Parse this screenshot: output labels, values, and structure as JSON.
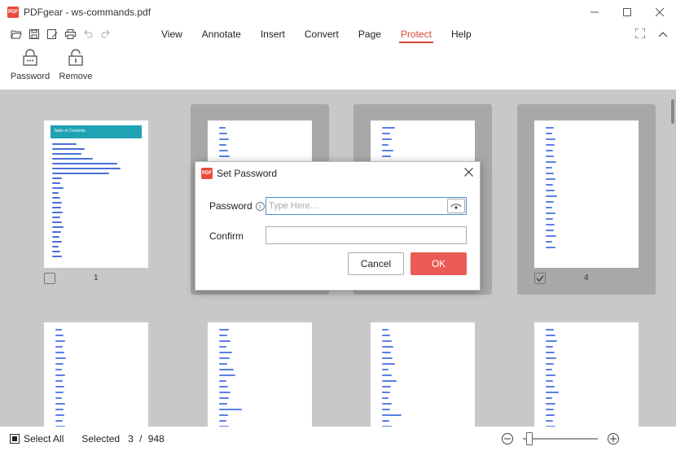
{
  "window": {
    "title": "PDFgear - ws-commands.pdf",
    "logo_text": "PDF"
  },
  "menus": [
    "View",
    "Annotate",
    "Insert",
    "Convert",
    "Page",
    "Protect",
    "Help"
  ],
  "active_menu": "Protect",
  "ribbon": {
    "password_label": "Password",
    "remove_label": "Remove"
  },
  "pages": [
    {
      "number": "1",
      "checked": false,
      "toc_title": "Table of Contents"
    },
    {
      "number": "",
      "checked": false
    },
    {
      "number": "",
      "checked": false
    },
    {
      "number": "4",
      "checked": true
    }
  ],
  "dialog": {
    "title": "Set Password",
    "password_label": "Password",
    "password_placeholder": "Type Here...",
    "confirm_label": "Confirm",
    "cancel_label": "Cancel",
    "ok_label": "OK"
  },
  "status": {
    "select_all_label": "Select All",
    "selected_label": "Selected",
    "selected_count": "3",
    "separator": "/",
    "total_pages": "948"
  },
  "colors": {
    "accent": "#d9453a",
    "ok_button": "#ea5b55",
    "workspace_bg": "#c8c8c8",
    "text_lines": "#5b7fe3"
  }
}
